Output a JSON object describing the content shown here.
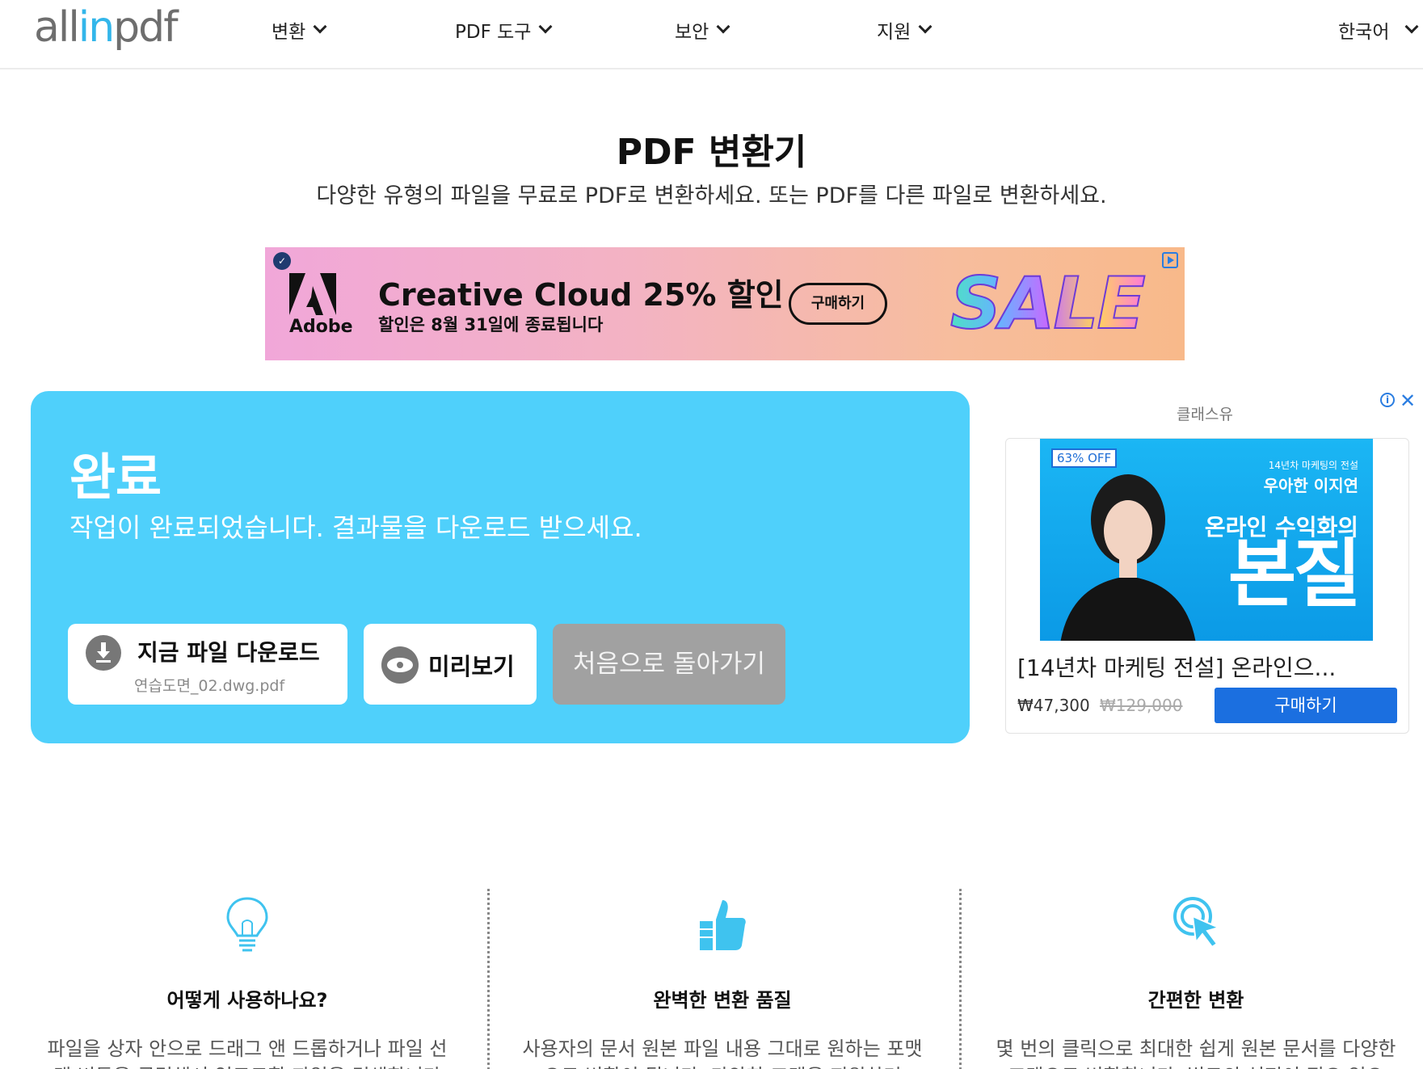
{
  "header": {
    "logo_prefix": "all",
    "logo_accent": "in",
    "logo_suffix": "pdf",
    "nav": [
      "변환",
      "PDF 도구",
      "보안",
      "지원"
    ],
    "language": "한국어"
  },
  "hero": {
    "title": "PDF 변환기",
    "subtitle": "다양한 유형의 파일을 무료로 PDF로 변환하세요. 또는 PDF를 다른 파일로 변환하세요."
  },
  "top_ad": {
    "brand": "Adobe",
    "headline": "Creative Cloud 25% 할인",
    "subtext": "할인은 8월 31일에 종료됩니다",
    "cta": "구매하기",
    "art_text": "SALE"
  },
  "completion": {
    "title": "완료",
    "message": "작업이 완료되었습니다. 결과물을 다운로드 받으세요.",
    "download_label": "지금 파일 다운로드",
    "file_name": "연습도면_02.dwg.pdf",
    "preview_label": "미리보기",
    "back_label": "처음으로 돌아가기"
  },
  "side_ad": {
    "advertiser": "클래스유",
    "badge": "63% OFF",
    "image_line1": "14년차 마케팅의 전설",
    "image_line2": "우아한 이지연",
    "image_line3": "온라인 수익화의",
    "image_line4": "본질",
    "title": "[14년차 마케팅 전설] 온라인으...",
    "price": "₩47,300",
    "old_price": "₩129,000",
    "cta": "구매하기"
  },
  "features": [
    {
      "title": "어떻게 사용하나요?",
      "text": "파일을 상자 안으로 드래그 앤 드롭하거나 파일 선택 버튼을 클릭해서 업로드할 파일을 검색합니다"
    },
    {
      "title": "완벽한 변환 품질",
      "text": "사용자의 문서 원본 파일 내용 그대로 원하는 포맷으로 변환이 됩니다. 다양한 포맷을 지원하며"
    },
    {
      "title": "간편한 변환",
      "text": "몇 번의 클릭으로 최대한 쉽게 원본 문서를 다양한 포맷으로 변환합니다. 별도의 설정이 필요 없으"
    }
  ],
  "colors": {
    "accent": "#4fd0fb",
    "logo_accent": "#33b6ea",
    "buy_button": "#1b6fe0",
    "back_button": "#a1a1a1"
  }
}
